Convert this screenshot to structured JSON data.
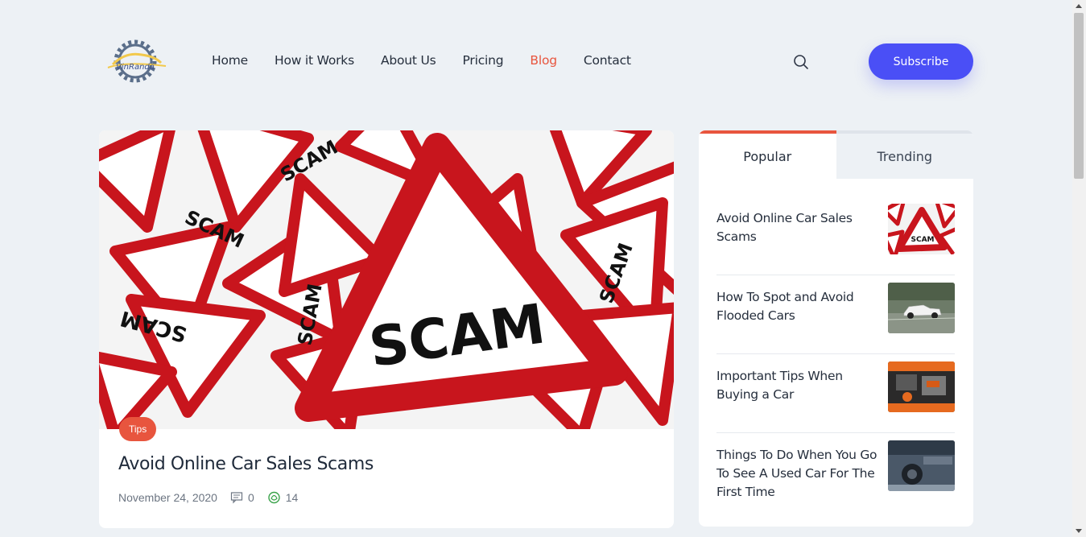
{
  "brand": {
    "logo_text": "VinRanda"
  },
  "nav": [
    {
      "label": "Home",
      "active": false
    },
    {
      "label": "How it Works",
      "active": false
    },
    {
      "label": "About Us",
      "active": false
    },
    {
      "label": "Pricing",
      "active": false
    },
    {
      "label": "Blog",
      "active": true
    },
    {
      "label": "Contact",
      "active": false
    }
  ],
  "header": {
    "subscribe_label": "Subscribe"
  },
  "colors": {
    "accent": "#e8553e",
    "primary": "#4a4ff6",
    "background": "#edf1f5"
  },
  "post": {
    "tag": "Tips",
    "title": "Avoid Online Car Sales Scams",
    "date": "November 24, 2020",
    "comments": "0",
    "views": "14",
    "image_sign_text": "SCAM"
  },
  "sidebar": {
    "tabs": [
      "Popular",
      "Trending"
    ],
    "items": [
      {
        "title": "Avoid Online Car Sales Scams",
        "thumb_text": "SCAM"
      },
      {
        "title": "How To Spot and Avoid Flooded Cars"
      },
      {
        "title": "Important Tips When Buying a Car"
      },
      {
        "title": "Things To Do When You Go To See A Used Car For The First Time"
      }
    ]
  }
}
